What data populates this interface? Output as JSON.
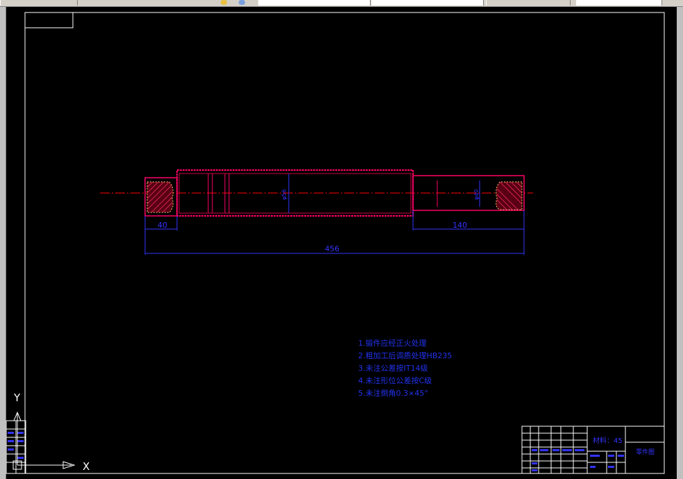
{
  "app": {
    "toolbar_segments": 6
  },
  "colors": {
    "background": "#000000",
    "frame": "#ffffff",
    "part_outline": "#ff0066",
    "hatch": "#ff3366",
    "center_line": "#ff0000",
    "dimension": "#3333ff",
    "notes": "#2233ee",
    "ucs": "#ffffff"
  },
  "drawing": {
    "dimensions": {
      "left_length": "40",
      "right_length": "140",
      "total_length": "456",
      "main_dia": "φ56",
      "right_dia": "φ40"
    },
    "notes": [
      "1.锻件应经正火处理",
      "2.粗加工后调质处理HB235",
      "3.未注公差按IT14级",
      "4.未注形位公差按C级",
      "5.未注倒角0.3×45°"
    ],
    "title_block": {
      "material": "材料：45",
      "drawing_name": "零件图"
    },
    "ucs": {
      "x_label": "X",
      "y_label": "Y"
    }
  }
}
